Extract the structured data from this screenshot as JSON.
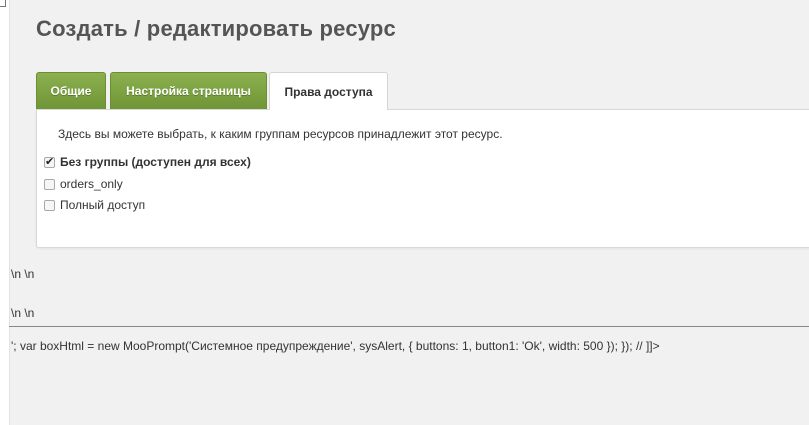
{
  "page": {
    "title": "Создать / редактировать ресурс"
  },
  "tabs": [
    {
      "label": "Общие",
      "active": false
    },
    {
      "label": "Настройка страницы",
      "active": false
    },
    {
      "label": "Права доступа",
      "active": true
    }
  ],
  "access": {
    "description": "Здесь вы можете выбрать, к каким группам ресурсов принадлежит этот ресурс.",
    "groups": [
      {
        "label": "Без группы (доступен для всех)",
        "checked": true
      },
      {
        "label": "orders_only",
        "checked": false
      },
      {
        "label": "Полный доступ",
        "checked": false
      }
    ]
  },
  "raw_output": {
    "line1": "\\n \\n",
    "line2": "\\n \\n",
    "script_line": "'; var boxHtml = new MooPrompt('Системное предупреждение', sysAlert, { buttons: 1, button1: 'Ok', width: 500 }); }); // ]]>"
  },
  "colors": {
    "tab_green": "#7aa33f",
    "background": "#f1f1f1",
    "panel": "#ffffff"
  }
}
